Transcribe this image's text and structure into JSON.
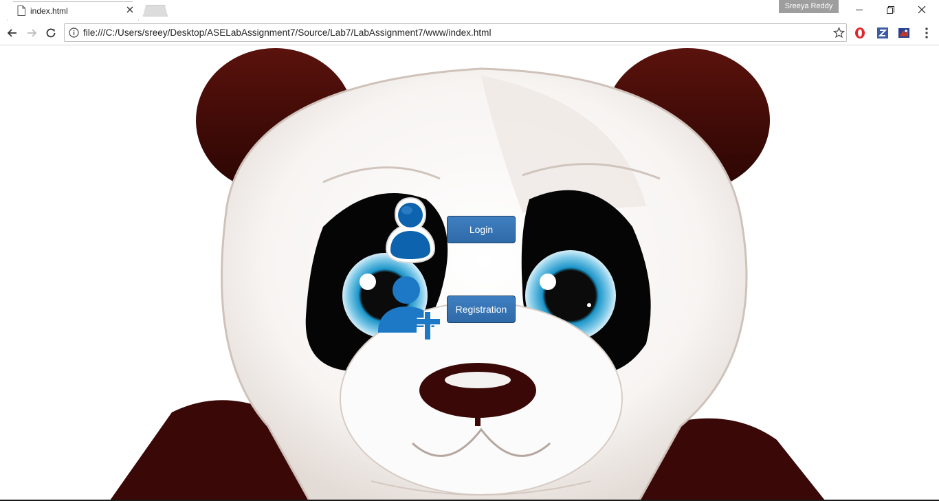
{
  "browser": {
    "tab": {
      "title": "index.html"
    },
    "profile_name": "Sreeya  Reddy",
    "address_bar": {
      "url": "file:///C:/Users/sreey/Desktop/ASELabAssignment7/Source/Lab7/LabAssignment7/www/index.html"
    },
    "icons": [
      "page-icon",
      "close-icon",
      "back-icon",
      "forward-icon",
      "reload-icon",
      "info-icon",
      "star-icon",
      "opera-icon",
      "z-extension-icon",
      "extension-icon",
      "menu-icon",
      "minimize-icon",
      "restore-icon",
      "window-close-icon"
    ]
  },
  "page": {
    "background": "panda-illustration",
    "login_button": {
      "label": "Login"
    },
    "registration_button": {
      "label": "Registration"
    }
  },
  "colors": {
    "button_blue": "#3a78b8",
    "icon_blue": "#1f6db3",
    "panda_dark": "#3a0a06"
  }
}
